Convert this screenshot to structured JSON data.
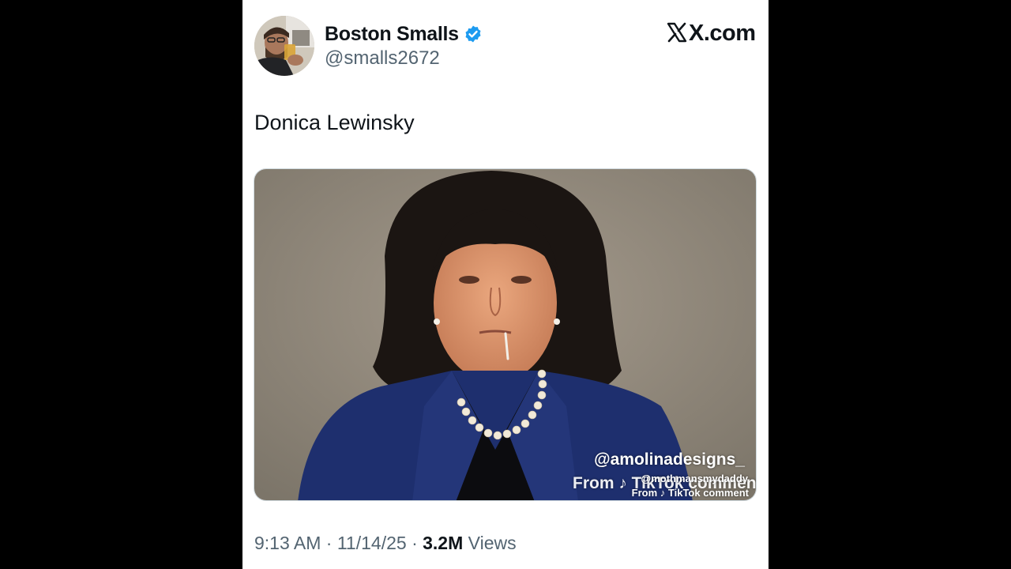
{
  "post": {
    "display_name": "Boston Smalls",
    "verified": true,
    "handle": "@smalls2672",
    "site_logo": "X.com",
    "text": "Donica Lewinsky",
    "media": {
      "watermark_primary": "@amolinadesigns_",
      "watermark_from_large": "From ♪ TikTok comment",
      "watermark_secondary_handle": "@mothmansmydaddy",
      "watermark_from_small": "From ♪ TikTok comment"
    },
    "time": "9:13 AM",
    "date": "11/14/25",
    "separator": "·",
    "views_count": "3.2M",
    "views_label": "Views"
  },
  "colors": {
    "outer_background": "#000000",
    "card_background": "#ffffff",
    "text_primary": "#0f1419",
    "text_secondary": "#536471",
    "verified_blue": "#1d9bf0"
  },
  "icons": {
    "verified": "verified-badge-icon",
    "x_logo": "x-logo-icon",
    "tiktok": "tiktok-icon"
  }
}
